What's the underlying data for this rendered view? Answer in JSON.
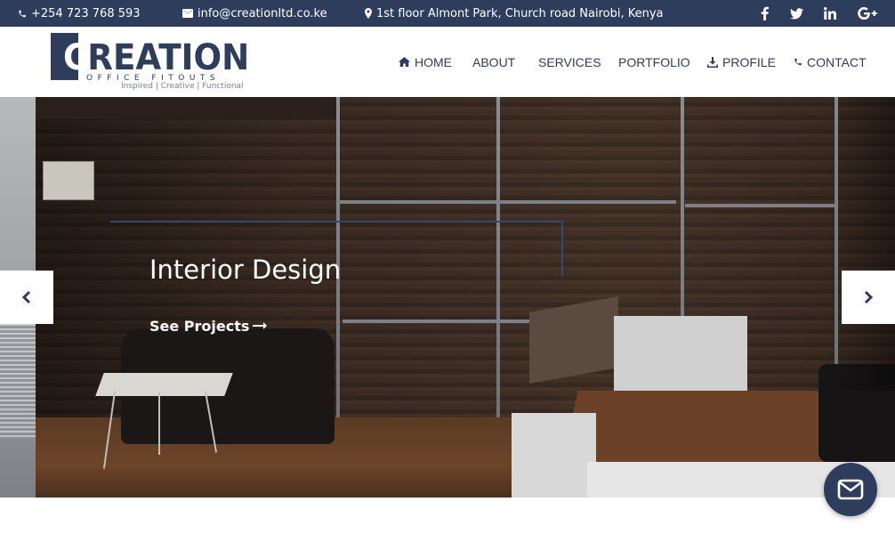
{
  "topbar": {
    "phone": "+254 723 768 593",
    "email": "info@creationltd.co.ke",
    "address": "1st floor Almont Park, Church road Nairobi, Kenya",
    "social": [
      "facebook-icon",
      "twitter-icon",
      "linkedin-icon",
      "google-plus-icon"
    ]
  },
  "logo": {
    "initial": "C",
    "word": "REATION",
    "subtitle": "OFFICE FITOUTS",
    "tagline": "Inspired | Creative | Functional"
  },
  "nav": {
    "home": "HOME",
    "about": "ABOUT",
    "services": "SERVICES",
    "portfolio": "PORTFOLIO",
    "profile": "PROFILE",
    "contact": "CONTACT"
  },
  "hero": {
    "title": "Interior Design",
    "link_label": "See Projects"
  },
  "colors": {
    "brand_navy": "#2f3d5c",
    "accent_line": "#2f4a6e",
    "white": "#ffffff"
  }
}
